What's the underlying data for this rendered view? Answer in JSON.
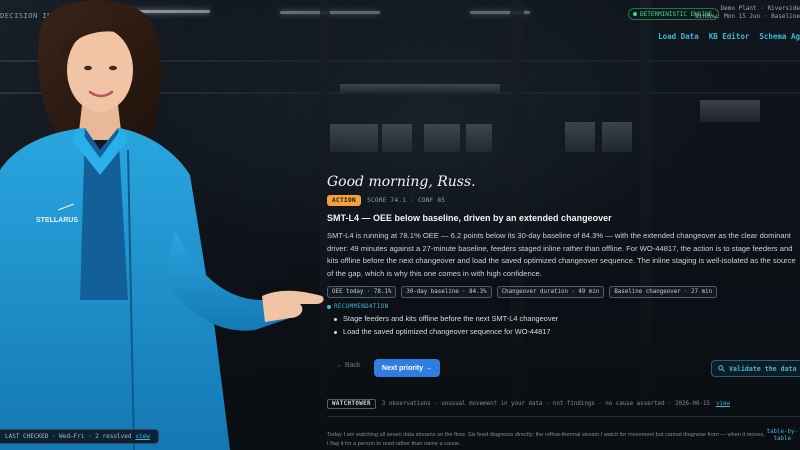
{
  "header": {
    "brand": "DECISION INTELLIGENCE",
    "engine_badge": "DETERMINISTIC ENGINE",
    "site_line1": "Demo Plant · Riverside",
    "site_line2": "Window: Mon 15 Jun · Baseline",
    "nav": [
      "Load Data",
      "KB Editor",
      "Schema Ag"
    ]
  },
  "person": {
    "logo_text": "STELLARUS"
  },
  "main": {
    "greeting": "Good morning, Russ.",
    "action_tag": "ACTION",
    "score": "SCORE 74.1 · CONF 85",
    "headline": "SMT-L4 — OEE below baseline, driven by an extended changeover",
    "body": "SMT-L4 is running at 78.1% OEE — 6.2 points below its 30-day baseline of 84.3% — with the extended changeover as the clear dominant driver: 49 minutes against a 27-minute baseline, feeders staged inline rather than offline. For WO-44817, the action is to stage feeders and kits offline before the next changeover and load the saved optimized changeover sequence. The inline staging is well-isolated as the source of the gap, which is why this one comes in with high confidence.",
    "chips": [
      "OEE today · 78.1%",
      "30-day baseline · 84.3%",
      "Changeover duration · 49 min",
      "Baseline changeover · 27 min"
    ],
    "recommendation_label": "RECOMMENDATION",
    "recommendations": [
      "Stage feeders and kits offline before the next SMT-L4 changeover",
      "Load the saved optimized changeover sequence for WO-44817"
    ]
  },
  "controls": {
    "back": "← Back",
    "next": "Next priority →",
    "validate": "Validate the data",
    "validate_icon": "search-icon"
  },
  "watchtower": {
    "tag": "WATCHTOWER",
    "summary": "3 observations · unusual movement in your data · not findings · no cause asserted · 2026-06-15",
    "link": "view"
  },
  "footer": {
    "text": "Today I am watching all seven data streams on the floor. Six feed diagnosis directly; the reflow-thermal stream I watch for movement but cannot diagnose from — when it moves, I flag it for a person to read rather than name a cause.",
    "link_line1": "table-by-",
    "link_line2": "table",
    "last_checked": "LAST CHECKED · Wed–Fri · 2 resolved",
    "last_checked_link": "view"
  },
  "colors": {
    "accent": "#3db7d6",
    "action": "#f2a33a",
    "primary_button": "#2f7de0",
    "engine_green": "#4fd19a",
    "jacket": "#1f9bd6"
  }
}
